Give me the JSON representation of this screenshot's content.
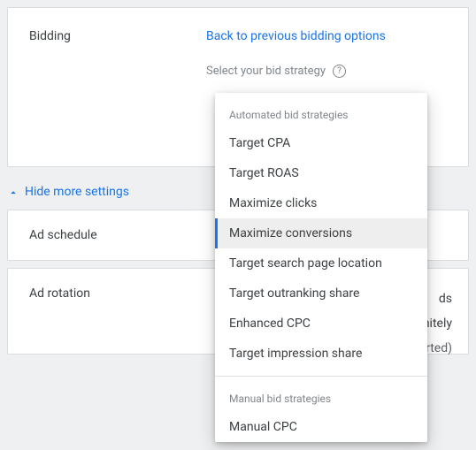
{
  "bidding": {
    "label": "Bidding",
    "back_link": "Back to previous bidding options",
    "select_label": "Select your bid strategy"
  },
  "hide_settings": {
    "label": "Hide more settings"
  },
  "ad_schedule": {
    "label": "Ad schedule"
  },
  "ad_rotation": {
    "label": "Ad rotation",
    "bg_line1_suffix": "ds",
    "bg_line2_suffix": "nitely",
    "bg_line3_suffix": "ported)"
  },
  "dropdown": {
    "group1_label": "Automated bid strategies",
    "group2_label": "Manual bid strategies",
    "options_auto": [
      "Target CPA",
      "Target ROAS",
      "Maximize clicks",
      "Maximize conversions",
      "Target search page location",
      "Target outranking share",
      "Enhanced CPC",
      "Target impression share"
    ],
    "options_manual": [
      "Manual CPC"
    ],
    "selected_index": 3
  }
}
